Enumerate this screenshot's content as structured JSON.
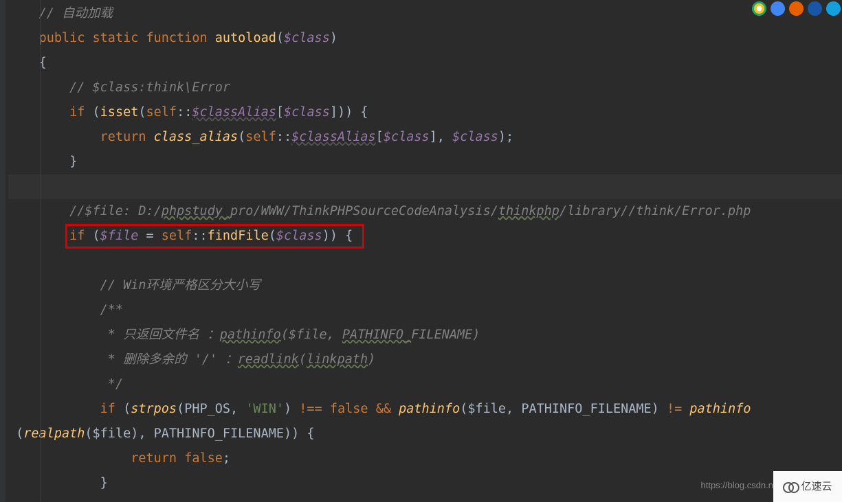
{
  "code": {
    "c1": "// 自动加载",
    "fn_public": "public",
    "fn_static": "static",
    "fn_function": "function",
    "fn_name": "autoload",
    "fn_param": "$class",
    "brace_open": "{",
    "c2": "// $class:think\\Error",
    "if1": "if",
    "isset": "isset",
    "self": "self",
    "dcolon": "::",
    "classAlias": "$classAlias",
    "return": "return",
    "class_alias": "class_alias",
    "c3_prefix": "//$file: D:/",
    "c3_wave1": "phpstudy_",
    "c3_mid": "pro/WWW/ThinkPHPSourceCodeAnalysis/",
    "c3_wave2": "thinkphp",
    "c3_suffix": "/library//think/Error.php",
    "file_var": "$file",
    "findFile": "findFile",
    "c4": "// Win环境严格区分大小写",
    "doc_open": "/**",
    "doc_l1_prefix": " * 只返回文件名 ：",
    "pathinfo": "pathinfo",
    "doc_l1_args": "($file, ",
    "PATHINFO_underscore": "PATHINFO_",
    "FILENAME": "FILENAME)",
    "doc_l2_prefix": " * 删除多余的 '/' ：",
    "readlink": "readlink",
    "linkpath": "linkpath",
    "doc_close": " */",
    "strpos": "strpos",
    "PHP_OS": "PHP_OS",
    "winstr": "'WIN'",
    "neq": "!==",
    "false": "false",
    "and": "&&",
    "pathinfo2_args": "($file, PATHINFO_FILENAME)",
    "neq2": "!=",
    "realpath": "realpath",
    "tail_args": "($file), PATHINFO_FILENAME)) {",
    "semi": ";",
    "brace_close": "}"
  },
  "watermark": "https://blog.csdn.n",
  "logo_text": "亿速云"
}
